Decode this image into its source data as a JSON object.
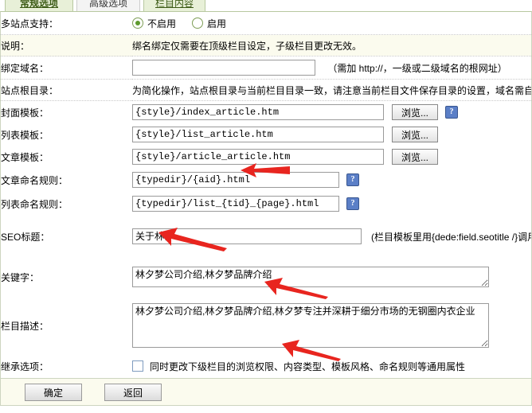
{
  "tabs": [
    {
      "label": "常规选项",
      "state": "active"
    },
    {
      "label": "高级选项",
      "state": "plain"
    },
    {
      "label": "栏目内容",
      "state": "green"
    }
  ],
  "rows": {
    "multisite": {
      "label": "多站点支持：",
      "options": [
        {
          "label": "不启用",
          "selected": true
        },
        {
          "label": "启用",
          "selected": false
        }
      ]
    },
    "explain": {
      "label": "说明：",
      "text": "绑名绑定仅需要在顶级栏目设定，子级栏目更改无效。"
    },
    "bind_domain": {
      "label": "绑定域名：",
      "value": "",
      "note": "（需加 http://，一级或二级域名的根网址）"
    },
    "site_root": {
      "label": "站点根目录：",
      "text": "为简化操作，站点根目录与当前栏目目录一致，请注意当前栏目文件保存目录的设置，域名需自"
    },
    "index_tpl": {
      "label": "封面模板：",
      "value": "{style}/index_article.htm",
      "browse": "浏览...",
      "help": "?"
    },
    "list_tpl": {
      "label": "列表模板：",
      "value": "{style}/list_article.htm",
      "browse": "浏览..."
    },
    "article_tpl": {
      "label": "文章模板：",
      "value": "{style}/article_article.htm",
      "browse": "浏览..."
    },
    "article_rule": {
      "label": "文章命名规则：",
      "value": "{typedir}/{aid}.html",
      "help": "?"
    },
    "list_rule": {
      "label": "列表命名规则：",
      "value": "{typedir}/list_{tid}_{page}.html",
      "help": "?"
    },
    "seo_title": {
      "label": "SEO标题：",
      "value": "关于林夕",
      "note": "(栏目模板里用{dede:field.seotitle /}调用"
    },
    "keywords": {
      "label": "关键字：",
      "value": "林夕梦公司介绍,林夕梦品牌介绍"
    },
    "description": {
      "label": "栏目描述：",
      "value": "林夕梦公司介绍,林夕梦品牌介绍,林夕梦专注并深耕于细分市场的无钢圈内衣企业"
    },
    "inherit": {
      "label": "继承选项：",
      "checkbox_label": "同时更改下级栏目的浏览权限、内容类型、模板风格、命名规则等通用属性",
      "checked": false
    }
  },
  "footer": {
    "confirm": "确定",
    "back": "返回"
  },
  "colors": {
    "accent_green": "#5e9a2e",
    "tab_active_bg": "#e8f0d8",
    "row_tint": "#fbfbee",
    "arrow_red": "#e8251f"
  }
}
